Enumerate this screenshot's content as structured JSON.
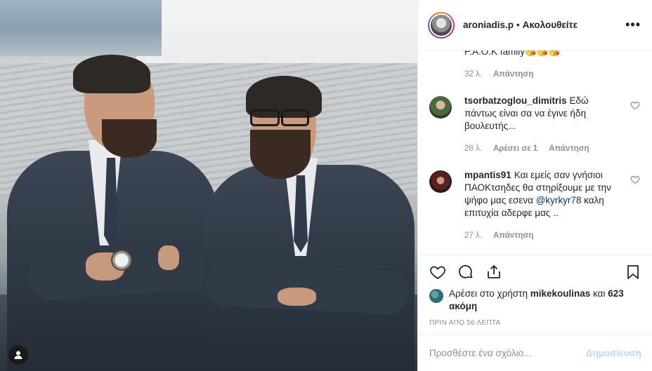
{
  "header": {
    "username": "aroniadis.p",
    "separator": "•",
    "follow_label": "Ακολουθείτε",
    "more_icon": "more-horizontal-icon"
  },
  "comments": {
    "partial": {
      "text": "P.A.O.K family😘😘😘",
      "time": "32 λ.",
      "reply_label": "Απάντηση"
    },
    "items": [
      {
        "username": "tsorbatzoglou_dimitris",
        "text": "Εδώ πάντως είναι σα να έγινε ήδη βουλευτής...",
        "time": "28 λ.",
        "likes_label": "Αρέσει σε 1",
        "reply_label": "Απάντηση"
      },
      {
        "username": "mpantis91",
        "text_before": "Και εμείς σαν γνήσιοι ΠΑΟΚτσηδες θα στηρίξουμε με την ψήφο μας εσενα",
        "mention": "@kyrkyr78",
        "text_after": "καλη επιτυχία αδερφε μας ..",
        "time": "27 λ.",
        "reply_label": "Απάντηση"
      }
    ]
  },
  "likes": {
    "prefix": "Αρέσει στο χρήστη",
    "user": "mikekoulinas",
    "middle": "και",
    "count": "623 ακόμη"
  },
  "timestamp": "ΠΡΙΝ ΑΠΟ 56 ΛΕΠΤΑ",
  "add_comment": {
    "placeholder": "Προσθέστε ένα σχόλιο...",
    "post_label": "Δημοσίευση"
  },
  "icons": {
    "like": "heart-icon",
    "comment": "comment-icon",
    "share": "share-icon",
    "save": "bookmark-icon",
    "photo_tags": "user-icon"
  }
}
